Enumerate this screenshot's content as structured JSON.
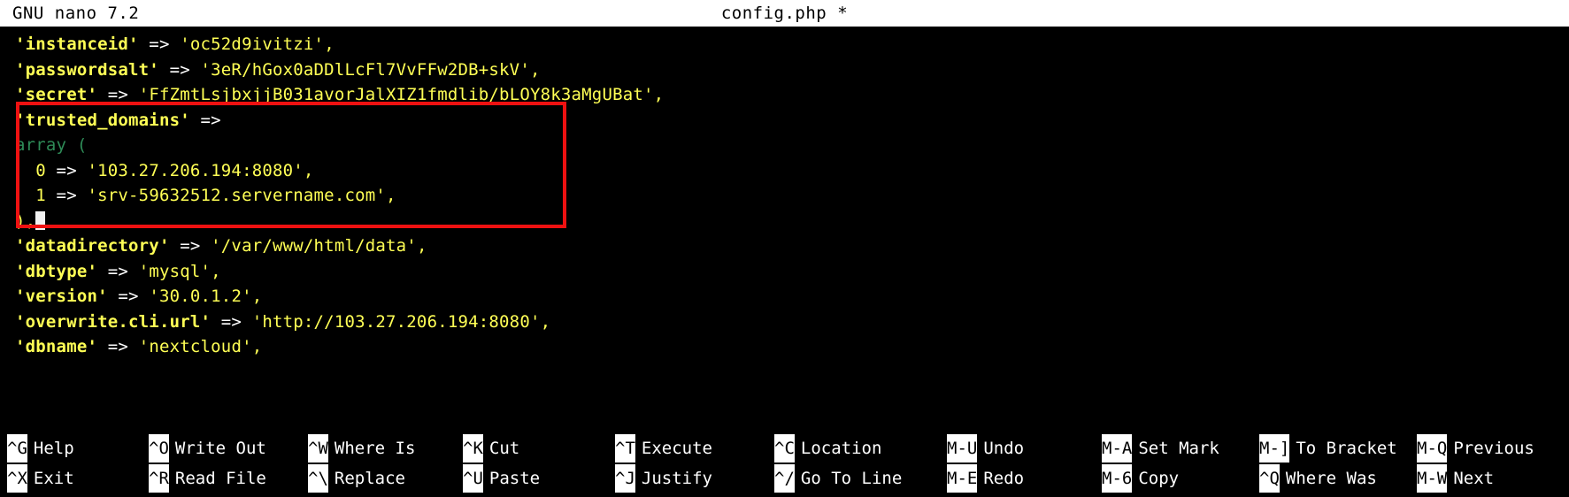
{
  "titlebar": {
    "version": "GNU nano 7.2",
    "filename": "config.php *"
  },
  "editor": {
    "cursor_glyph": "block-cursor",
    "lines": [
      {
        "id": "instanceid",
        "text": "'instanceid' => 'oc52d9ivitzi',"
      },
      {
        "id": "passwordsalt",
        "text": "'passwordsalt' => '3eR/hGox0aDDlLcFl7VvFFw2DB+skV',"
      },
      {
        "id": "secret",
        "text": "'secret' => 'FfZmtLsjbxjjB031avorJalXIZ1fmdlib/bLOY8k3aMgUBat',"
      },
      {
        "id": "trusted-domains",
        "text": "'trusted_domains' =>"
      },
      {
        "id": "array-open",
        "text": "array ("
      },
      {
        "id": "domain-0",
        "text": "  0 => '103.27.206.194:8080',"
      },
      {
        "id": "domain-1",
        "text": "  1 => 'srv-59632512.servername.com',"
      },
      {
        "id": "array-close",
        "text": "),"
      },
      {
        "id": "datadirectory",
        "text": "'datadirectory' => '/var/www/html/data',"
      },
      {
        "id": "dbtype",
        "text": "'dbtype' => 'mysql',"
      },
      {
        "id": "version",
        "text": "'version' => '30.0.1.2',"
      },
      {
        "id": "overwrite-cli-url",
        "text": "'overwrite.cli.url' => 'http://103.27.206.194:8080',"
      },
      {
        "id": "dbname",
        "text": "'dbname' => 'nextcloud',"
      }
    ],
    "tokens": {
      "instanceid": {
        "key": "'instanceid'",
        "arrow": " => ",
        "value": "'oc52d9ivitzi'",
        "comma": ","
      },
      "passwordsalt": {
        "key": "'passwordsalt'",
        "arrow": " => ",
        "value": "'3eR/hGox0aDDlLcFl7VvFFw2DB+skV'",
        "comma": ","
      },
      "secret": {
        "key": "'secret'",
        "arrow": " => ",
        "value": "'FfZmtLsjbxjjB031avorJalXIZ1fmdlib/bLOY8k3aMgUBat'",
        "comma": ","
      },
      "trusted_domains": {
        "key": "'trusted_domains'",
        "arrow": " =>"
      },
      "array_open": {
        "fn": "array",
        "paren": " ("
      },
      "domain_0": {
        "index": "  0",
        "arrow": " => ",
        "value": "'103.27.206.194:8080'",
        "comma": ","
      },
      "domain_1": {
        "index": "  1",
        "arrow": " => ",
        "value": "'srv-59632512.servername.com'",
        "comma": ","
      },
      "array_close": {
        "text": "),"
      },
      "datadirectory": {
        "key": "'datadirectory'",
        "arrow": " => ",
        "value": "'/var/www/html/data'",
        "comma": ","
      },
      "dbtype": {
        "key": "'dbtype'",
        "arrow": " => ",
        "value": "'mysql'",
        "comma": ","
      },
      "version": {
        "key": "'version'",
        "arrow": " => ",
        "value": "'30.0.1.2'",
        "comma": ","
      },
      "overwrite_cli_url": {
        "key": "'overwrite.cli.url'",
        "arrow": " => ",
        "value": "'http://103.27.206.194:8080'",
        "comma": ","
      },
      "dbname": {
        "key": "'dbname'",
        "arrow": " => ",
        "value": "'nextcloud'",
        "comma": ","
      }
    }
  },
  "annotation": {
    "color": "#ee1111",
    "label": "trusted_domains-highlight"
  },
  "colors": {
    "background": "#000000",
    "string": "#ffff55",
    "operator": "#ffffff",
    "function": "#2e8b57",
    "titlebar_bg": "#ffffff",
    "titlebar_fg": "#000000",
    "highlight": "#ee1111"
  },
  "helpbar": {
    "columns": [
      {
        "top": {
          "key": "^G",
          "label": "Help"
        },
        "bottom": {
          "key": "^X",
          "label": "Exit"
        }
      },
      {
        "top": {
          "key": "^O",
          "label": "Write Out"
        },
        "bottom": {
          "key": "^R",
          "label": "Read File"
        }
      },
      {
        "top": {
          "key": "^W",
          "label": "Where Is"
        },
        "bottom": {
          "key": "^\\",
          "label": "Replace"
        }
      },
      {
        "top": {
          "key": "^K",
          "label": "Cut"
        },
        "bottom": {
          "key": "^U",
          "label": "Paste"
        }
      },
      {
        "top": {
          "key": "^T",
          "label": "Execute"
        },
        "bottom": {
          "key": "^J",
          "label": "Justify"
        }
      },
      {
        "top": {
          "key": "^C",
          "label": "Location"
        },
        "bottom": {
          "key": "^/",
          "label": "Go To Line"
        }
      },
      {
        "top": {
          "key": "M-U",
          "label": "Undo"
        },
        "bottom": {
          "key": "M-E",
          "label": "Redo"
        }
      },
      {
        "top": {
          "key": "M-A",
          "label": "Set Mark"
        },
        "bottom": {
          "key": "M-6",
          "label": "Copy"
        }
      },
      {
        "top": {
          "key": "M-]",
          "label": "To Bracket"
        },
        "bottom": {
          "key": "^Q",
          "label": "Where Was"
        }
      },
      {
        "top": {
          "key": "M-Q",
          "label": "Previous"
        },
        "bottom": {
          "key": "M-W",
          "label": "Next"
        }
      }
    ]
  }
}
